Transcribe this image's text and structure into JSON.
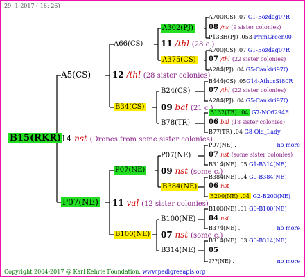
{
  "header": {
    "date": "29-  1-2017 ( 16: 26)"
  },
  "root": {
    "code": "B15(RKR)",
    "num": "14",
    "marker": "nst",
    "note": "(Drones from some sister colonies)"
  },
  "gen1": {
    "a5": {
      "code": "A5(CS)",
      "num": "12",
      "marker": "/thl",
      "note": "(28 sister colonies)"
    },
    "p07": {
      "code": "P07(NE)",
      "num": "11",
      "marker": "val",
      "note": "(12 sister colonies)"
    }
  },
  "gen2": {
    "a66": {
      "code": "A66(CS)",
      "num": "11",
      "marker": "/thl",
      "note": "(28 c.)"
    },
    "b34": {
      "code": "B34(CS)",
      "num": "09",
      "marker": "bal",
      "note": "(21 c.)"
    },
    "p07ne": {
      "code": "P07(NE)",
      "num": "09",
      "marker": "nst",
      "note": "(some c.)"
    },
    "b100": {
      "code": "B100(NE)",
      "num": "07",
      "marker": "nst",
      "note": "(some c.)"
    }
  },
  "gen3": {
    "a302": {
      "code": "A302(PJ)",
      "num": "08",
      "marker": "/ns",
      "note": "(9 sister colonies)"
    },
    "a375": {
      "code": "A375(CS)",
      "num": "07",
      "marker": "/thl",
      "note": "(22 sister colonies)"
    },
    "b24": {
      "code": "B24(CS)",
      "num": "07",
      "marker": "/thl",
      "note": "(22 sister colonies)"
    },
    "b78": {
      "code": "B78(TR)",
      "num": "06",
      "marker": "bal",
      "note": "(18 sister colonies)"
    },
    "p07ne2": {
      "code": "P07(NE)",
      "num": "07",
      "marker": "nst",
      "note": "(some sister colonies)"
    },
    "b384": {
      "code": "B384(NE)",
      "num": "06",
      "marker": "nst"
    },
    "b100ne": {
      "code": "B100(NE)",
      "num": "04",
      "marker": "nst"
    },
    "b314": {
      "code": "B314(NE)",
      "num": "05"
    }
  },
  "gen4": {
    "r1": {
      "code": "A700(CS)",
      "year": ".07",
      "pre": "G1",
      "line": "-Bozdag07R"
    },
    "r2": {
      "code": "P133H(PJ)",
      "year": ".053",
      "line": "-PrimGreen00"
    },
    "r3": {
      "code": "A700(CS)",
      "year": ".07",
      "pre": "G1",
      "line": "-Bozdag07R"
    },
    "r4": {
      "code": "A284(PJ)",
      "year": ".04",
      "pre": "G5",
      "line": "-Cankiri97Q"
    },
    "r5": {
      "code": "B444(CS)",
      "year": ".05",
      "pre": "G14",
      "line": "-AthosSt80R"
    },
    "r6": {
      "code": "A284(PJ)",
      "year": ".04",
      "pre": "G5",
      "line": "-Cankiri97Q"
    },
    "r7": {
      "code": "B132(TR)",
      "year": ".04",
      "pre": "G7",
      "line": "-NO6294R"
    },
    "r8": {
      "code": "B77(TR)",
      "year": ".04",
      "pre": "G8",
      "line": "-Old_Lady"
    },
    "r9": {
      "code": "P07(NE)",
      "year": ".",
      "line": "no more"
    },
    "r10": {
      "code": "B314(NE)",
      "year": ".05",
      "pre": "G1",
      "line": "-B314(NE)"
    },
    "r11": {
      "code": "B384(NE)",
      "year": ".04",
      "pre": "G0",
      "line": "-B384(NE)"
    },
    "r12": {
      "code": "B200(NE)",
      "year": ".04",
      "pre": "G2",
      "line": "-B200(NE)"
    },
    "r13": {
      "code": "B100(NE)",
      "year": ".01",
      "pre": "G0",
      "line": "-B100(NE)"
    },
    "r14": {
      "code": "B374(NE)",
      "year": ".",
      "line": "no more"
    },
    "r15": {
      "code": "B314(NE)",
      "year": ".03",
      "pre": "G0",
      "line": "-B314(NE)"
    },
    "r16": {
      "code": "???(NE)",
      "year": ".",
      "line": "no more"
    }
  },
  "footer": {
    "copyright": "Copyright 2004-2017 @ Karl Kehrle Foundation.",
    "url": "www.pedigreeapis.org"
  }
}
